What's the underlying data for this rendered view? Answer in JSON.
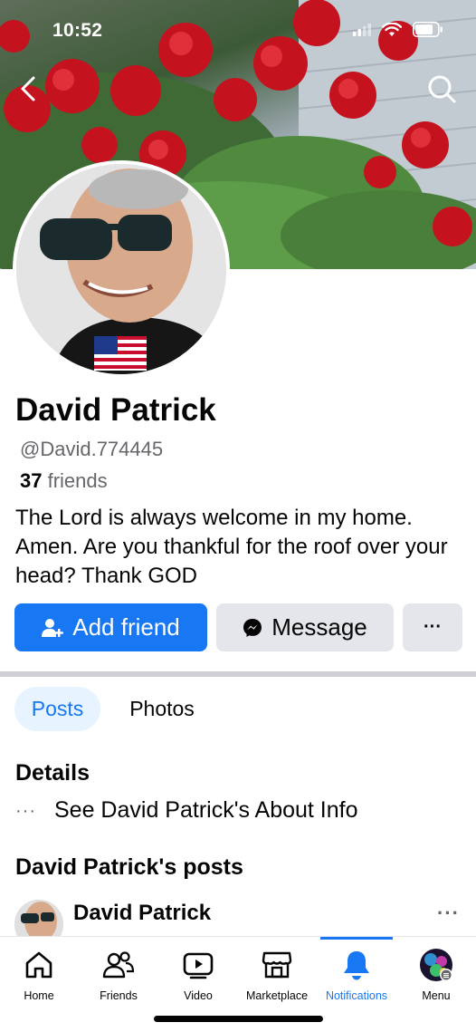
{
  "status_bar": {
    "time": "10:52"
  },
  "header": {
    "back_icon": "chevron-left-icon",
    "search_icon": "search-icon"
  },
  "profile": {
    "name": "David Patrick",
    "handle": "@David.774445",
    "friends_count": "37",
    "friends_label": "friends",
    "bio": "The Lord is always welcome in my home. Amen. Are you thankful for the roof over your head? Thank GOD"
  },
  "actions": {
    "add_friend": "Add friend",
    "message": "Message",
    "more": "···"
  },
  "tabs": [
    {
      "label": "Posts",
      "active": true
    },
    {
      "label": "Photos",
      "active": false
    }
  ],
  "details": {
    "title": "Details",
    "about_link": "See David Patrick's About Info"
  },
  "posts": {
    "title": "David Patrick's posts",
    "first_post_author": "David Patrick",
    "more": "···"
  },
  "bottom_nav": [
    {
      "label": "Home",
      "icon": "home-icon"
    },
    {
      "label": "Friends",
      "icon": "friends-icon"
    },
    {
      "label": "Video",
      "icon": "video-icon"
    },
    {
      "label": "Marketplace",
      "icon": "marketplace-icon"
    },
    {
      "label": "Notifications",
      "icon": "bell-icon",
      "active": true
    },
    {
      "label": "Menu",
      "icon": "menu-avatar-icon"
    }
  ],
  "colors": {
    "accent": "#1877f2",
    "button_gray": "#e4e6eb",
    "secondary_text": "#65676b"
  }
}
